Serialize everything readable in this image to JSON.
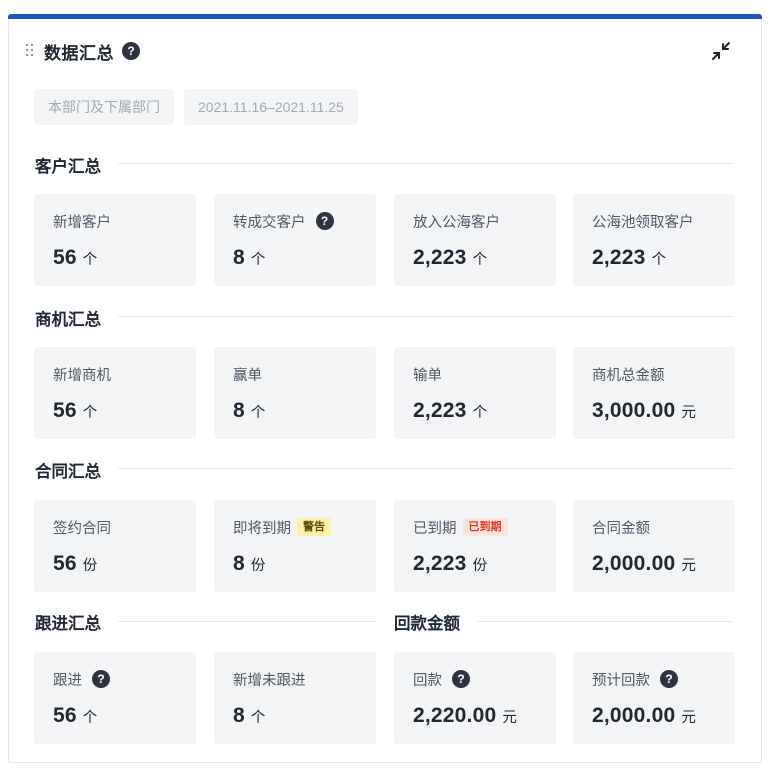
{
  "header": {
    "title": "数据汇总",
    "help_icon": "?",
    "collapse_icon": "collapse-arrows-icon"
  },
  "filters": [
    {
      "label": "本部门及下属部门"
    },
    {
      "label": "2021.11.16–2021.11.25"
    }
  ],
  "sections": {
    "customer": {
      "title": "客户汇总",
      "tiles": [
        {
          "label": "新增客户",
          "value": "56",
          "unit": "个"
        },
        {
          "label": "转成交客户",
          "value": "8",
          "unit": "个",
          "help": "?"
        },
        {
          "label": "放入公海客户",
          "value": "2,223",
          "unit": "个"
        },
        {
          "label": "公海池领取客户",
          "value": "2,223",
          "unit": "个"
        }
      ]
    },
    "opportunity": {
      "title": "商机汇总",
      "tiles": [
        {
          "label": "新增商机",
          "value": "56",
          "unit": "个"
        },
        {
          "label": "赢单",
          "value": "8",
          "unit": "个"
        },
        {
          "label": "输单",
          "value": "2,223",
          "unit": "个"
        },
        {
          "label": "商机总金额",
          "value": "3,000.00",
          "unit": "元"
        }
      ]
    },
    "contract": {
      "title": "合同汇总",
      "tiles": [
        {
          "label": "签约合同",
          "value": "56",
          "unit": "份"
        },
        {
          "label": "即将到期",
          "value": "8",
          "unit": "份",
          "badge": "警告"
        },
        {
          "label": "已到期",
          "value": "2,223",
          "unit": "份",
          "badge": "已到期"
        },
        {
          "label": "合同金额",
          "value": "2,000.00",
          "unit": "元"
        }
      ]
    },
    "followup": {
      "title": "跟进汇总",
      "tiles": [
        {
          "label": "跟进",
          "value": "56",
          "unit": "个",
          "help": "?"
        },
        {
          "label": "新增未跟进",
          "value": "8",
          "unit": "个"
        }
      ]
    },
    "payment": {
      "title": "回款金额",
      "tiles": [
        {
          "label": "回款",
          "value": "2,220.00",
          "unit": "元",
          "help": "?"
        },
        {
          "label": "预计回款",
          "value": "2,000.00",
          "unit": "元",
          "help": "?"
        }
      ]
    }
  },
  "colors": {
    "accent": "#1a56c8",
    "tile_bg": "#f3f4f6",
    "warn_bg": "#fcefa8",
    "expired_text": "#d93a23"
  }
}
